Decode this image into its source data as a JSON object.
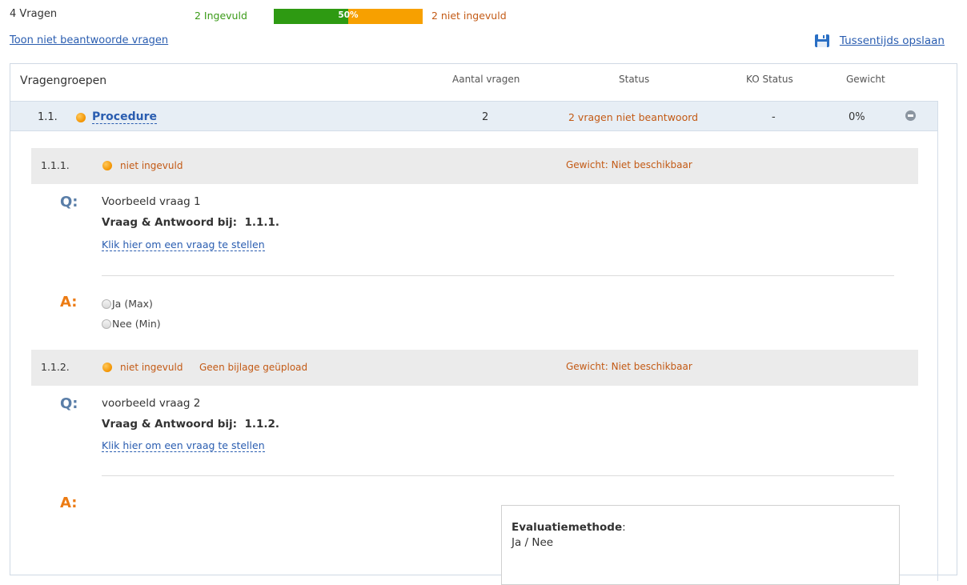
{
  "summary": {
    "question_count": "4 Vragen",
    "filled_label": "2 Ingevuld",
    "progress_percent_label": "50%",
    "progress_fraction": 0.5,
    "not_filled_label": "2 niet ingevuld",
    "show_unanswered_link": "Toon niet beantwoorde vragen",
    "save_link": "Tussentijds opslaan"
  },
  "table_header": {
    "groups": "Vragengroepen",
    "count": "Aantal vragen",
    "status": "Status",
    "ko_status": "KO Status",
    "weight": "Gewicht"
  },
  "group": {
    "number": "1.1.",
    "title": "Procedure",
    "count": "2",
    "status": "2 vragen niet beantwoord",
    "ko_status": "-",
    "weight": "0%"
  },
  "questions": [
    {
      "number": "1.1.1.",
      "state": "niet ingevuld",
      "attachment": "",
      "weight": "Gewicht: Niet beschikbaar",
      "q_letter": "Q:",
      "text": "Voorbeeld vraag 1",
      "qa_label": "Vraag & Antwoord bij:",
      "qa_ref": "1.1.1.",
      "ask_link": "Klik hier om een vraag te stellen",
      "a_letter": "A:",
      "options": [
        "Ja (Max)",
        "Nee (Min)"
      ]
    },
    {
      "number": "1.1.2.",
      "state": "niet ingevuld",
      "attachment": "Geen bijlage geüpload",
      "weight": "Gewicht: Niet beschikbaar",
      "q_letter": "Q:",
      "text": "voorbeeld vraag 2",
      "qa_label": "Vraag & Antwoord bij:",
      "qa_ref": "1.1.2.",
      "ask_link": "Klik hier om een vraag te stellen",
      "a_letter": "A:",
      "evaluation_label": "Evaluatiemethode",
      "evaluation_value": "Ja / Nee"
    }
  ],
  "colors": {
    "link": "#2a5db0",
    "progress_filled": "#2e9a12",
    "progress_empty": "#f7a000",
    "warning_text": "#c35a15",
    "group_bg": "#e7eef5",
    "question_bar_bg": "#ebebeb",
    "q_letter": "#5a7ea8",
    "a_letter": "#ec7b13"
  },
  "icons": {
    "save": "floppy-disk-icon",
    "status_dot": "orange-dot-icon",
    "collapse": "minus-circle-icon",
    "radio": "radio-button"
  }
}
